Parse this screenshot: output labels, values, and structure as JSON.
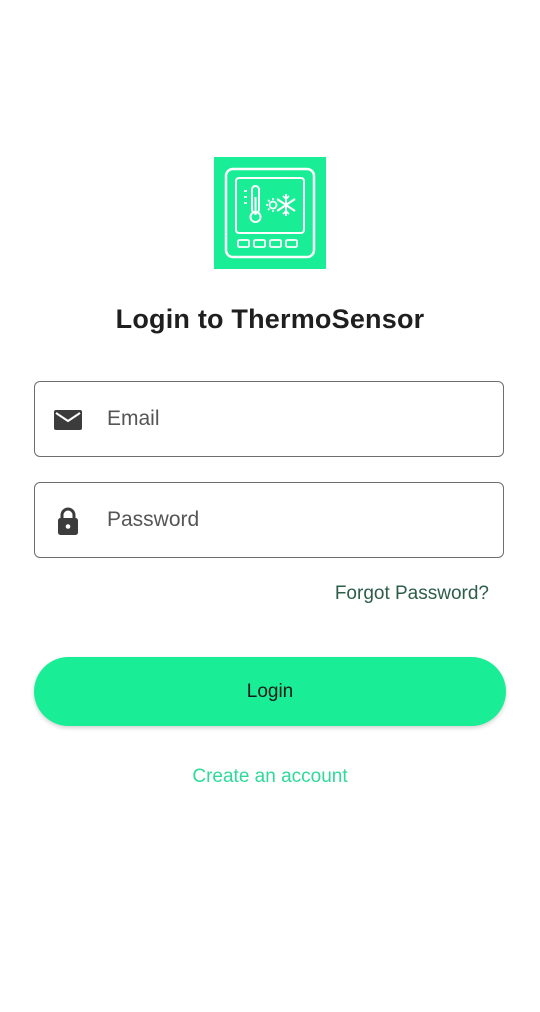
{
  "app": {
    "logo_icon": "thermostat-device-icon",
    "title": "Login to ThermoSensor"
  },
  "form": {
    "email": {
      "icon": "envelope-icon",
      "placeholder": "Email",
      "value": ""
    },
    "password": {
      "icon": "lock-icon",
      "placeholder": "Password",
      "value": ""
    },
    "forgot_label": "Forgot Password?",
    "login_label": "Login",
    "create_account_label": "Create an account"
  },
  "colors": {
    "brand": "#19ee97",
    "link_dark": "#2e5d4a",
    "link_accent": "#2ed99a",
    "text": "#1f1f1f"
  }
}
